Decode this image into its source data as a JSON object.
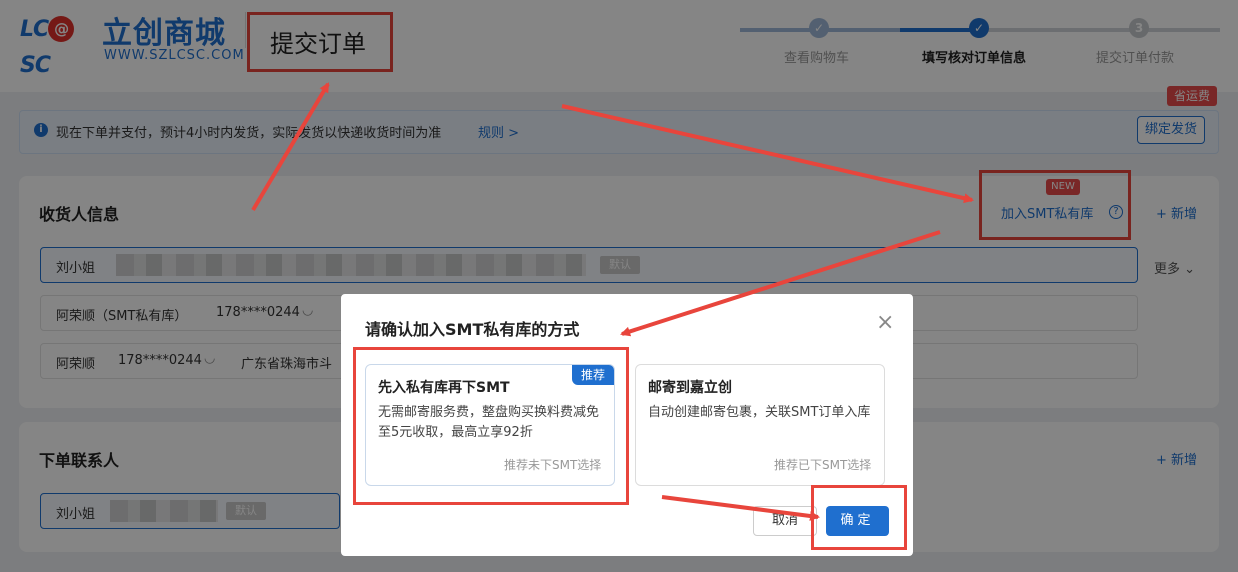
{
  "header": {
    "logo_mark_left": "LC",
    "logo_mark_at": "@",
    "logo_mark_right": "SC",
    "logo_name": "立创商城",
    "logo_url": "WWW.SZLCSC.COM",
    "page_title": "提交订单"
  },
  "steps": [
    {
      "label": "查看购物车",
      "state": "done",
      "number": ""
    },
    {
      "label": "填写核对订单信息",
      "state": "active",
      "number": ""
    },
    {
      "label": "提交订单付款",
      "state": "todo",
      "number": "3"
    }
  ],
  "notice": {
    "icon": "i",
    "text": "现在下单并支付，预计4小时内发货，实际发货以快递收货时间为准",
    "rules_link": "规则 >",
    "bind_button": "绑定发货",
    "save_badge": "省运费"
  },
  "receiver": {
    "title": "收货人信息",
    "smt_link": "加入SMT私有库",
    "new_badge": "NEW",
    "help_icon": "?",
    "add_link": "+ 新增",
    "more_link": "更多",
    "more_icon": "⌄",
    "rows": [
      {
        "name": "刘小姐",
        "phone": "",
        "address": "",
        "tag": "默认"
      },
      {
        "name": "阿荣顺（SMT私有库）",
        "phone": "178****0244",
        "address": "",
        "tag": ""
      },
      {
        "name": "阿荣顺",
        "phone": "178****0244",
        "address": "广东省珠海市斗",
        "tag": ""
      }
    ],
    "eye_icon": "◡"
  },
  "contact": {
    "title": "下单联系人",
    "add_link": "+ 新增",
    "rows": [
      {
        "name": "刘小姐",
        "tag": "默认"
      }
    ]
  },
  "modal": {
    "title": "请确认加入SMT私有库的方式",
    "close_icon": "×",
    "options": [
      {
        "title": "先入私有库再下SMT",
        "badge": "推荐",
        "desc": "无需邮寄服务费，整盘购买换料费减免至5元收取，最高立享92折",
        "hint": "推荐未下SMT选择"
      },
      {
        "title": "邮寄到嘉立创",
        "badge": "",
        "desc": "自动创建邮寄包裹，关联SMT订单入库",
        "hint": "推荐已下SMT选择"
      }
    ],
    "cancel_button": "取消",
    "confirm_button": "确定"
  },
  "colors": {
    "brand_blue": "#1f6fcf",
    "annotation_red": "#e8453c",
    "badge_red": "#e84c4c"
  }
}
